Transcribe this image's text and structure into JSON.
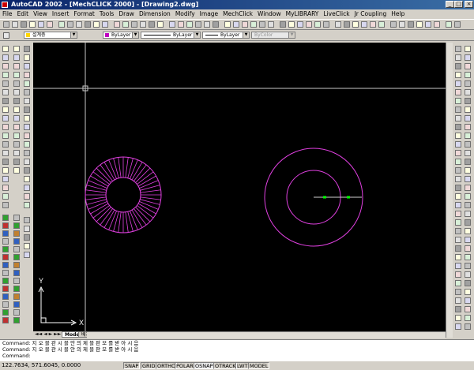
{
  "window": {
    "title": "AutoCAD 2002 - [MechCLICK 2000] - [Drawing2.dwg]",
    "buttons": [
      "_",
      "□",
      "×"
    ]
  },
  "menu": [
    "File",
    "Edit",
    "View",
    "Insert",
    "Format",
    "Tools",
    "Draw",
    "Dimension",
    "Modify",
    "Image",
    "MechClick",
    "Window",
    "MyLIBRARY",
    "LiveClick",
    "Jr Coupling",
    "Help"
  ],
  "props": {
    "layer": "설계층",
    "color": "ByLayer",
    "linetype": "ByLayer",
    "lineweight": "ByLayer",
    "plotstyle": "ByColor"
  },
  "colors": {
    "canvas": "#000000",
    "geometry": "#e040e0",
    "crosshair": "#c8c8c8"
  },
  "ucs": {
    "x_label": "X",
    "y_label": "Y"
  },
  "tabs": [
    "Model",
    "배치1"
  ],
  "command": {
    "lines": [
      "Command: 지 오 블 관 시 블 안 의 제 블 판 모 를 받 아 시 음",
      "Command: 지 오 블 관 시 블 안 의 제 블 판 모 를 받 아 시 음",
      "Command:"
    ]
  },
  "status": {
    "coords": "122.7634, 571.6045, 0.0000",
    "buttons": [
      "SNAP",
      "GRID",
      "ORTHO",
      "POLAR",
      "OSNAP",
      "OTRACK",
      "LWT",
      "MODEL"
    ]
  }
}
